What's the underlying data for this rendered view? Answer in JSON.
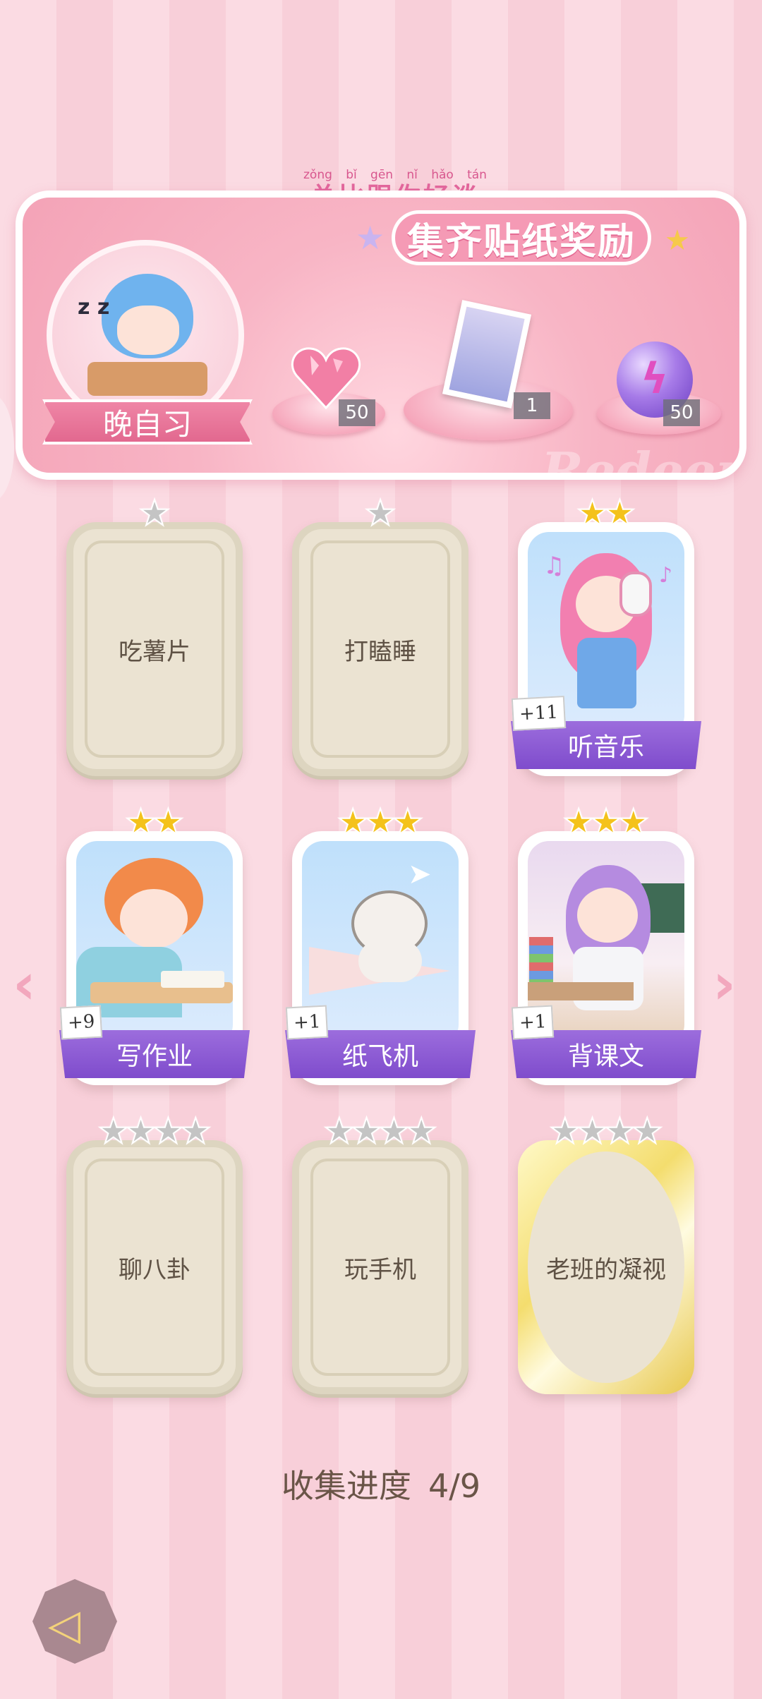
{
  "banner": {
    "pinyin": [
      "zǒng",
      "bǐ",
      "gēn",
      "nǐ",
      "hǎo",
      "tán"
    ],
    "slogan": "总比跟你好谈",
    "title": "集齐贴纸奖励",
    "watermark": "Redeem",
    "theme_label": "晚自习",
    "rewards": [
      {
        "icon": "heart-gem-icon",
        "count": "50"
      },
      {
        "icon": "photo-card-icon",
        "count": "1"
      },
      {
        "icon": "energy-orb-icon",
        "count": "50"
      }
    ]
  },
  "cards": [
    {
      "name": "吃薯片",
      "stars": 1,
      "collected": false,
      "plus": ""
    },
    {
      "name": "打瞌睡",
      "stars": 1,
      "collected": false,
      "plus": ""
    },
    {
      "name": "听音乐",
      "stars": 2,
      "collected": true,
      "plus": "+11"
    },
    {
      "name": "写作业",
      "stars": 2,
      "collected": true,
      "plus": "+9"
    },
    {
      "name": "纸飞机",
      "stars": 3,
      "collected": true,
      "plus": "+1"
    },
    {
      "name": "背课文",
      "stars": 3,
      "collected": true,
      "plus": "+1"
    },
    {
      "name": "聊八卦",
      "stars": 4,
      "collected": false,
      "plus": ""
    },
    {
      "name": "玩手机",
      "stars": 4,
      "collected": false,
      "plus": ""
    },
    {
      "name": "老班的凝视",
      "stars": 4,
      "collected": false,
      "plus": ""
    }
  ],
  "progress": {
    "label": "收集进度",
    "value": "4/9"
  },
  "colors": {
    "star_gold": "#f4c21b",
    "star_gray": "#c4c4c4",
    "card_banner": "#8b59d4",
    "accent_pink": "#f59ab5"
  }
}
